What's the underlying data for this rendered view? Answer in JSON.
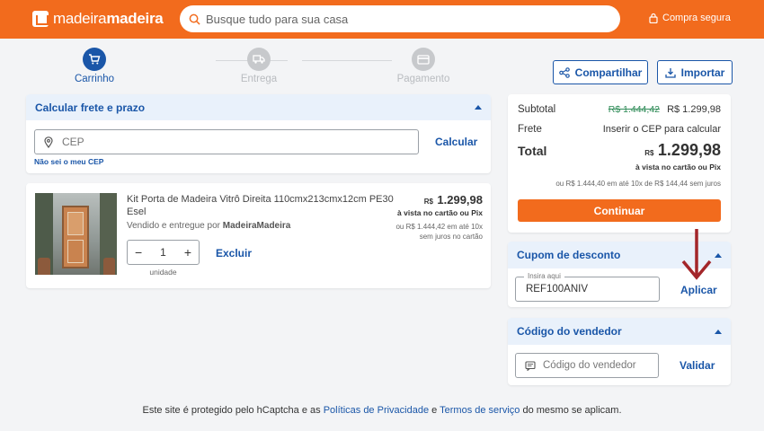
{
  "header": {
    "logo_part1": "madeira",
    "logo_part2": "madeira",
    "search_placeholder": "Busque tudo para sua casa",
    "secure_label": "Compra segura"
  },
  "steps": [
    {
      "label": "Carrinho",
      "icon": "cart-icon",
      "active": true
    },
    {
      "label": "Entrega",
      "icon": "truck-icon",
      "active": false
    },
    {
      "label": "Pagamento",
      "icon": "card-icon",
      "active": false
    }
  ],
  "actions": {
    "share_label": "Compartilhar",
    "import_label": "Importar"
  },
  "shipping": {
    "title": "Calcular frete e prazo",
    "cep_placeholder": "CEP",
    "calc_label": "Calcular",
    "unknown_cep_link": "Não sei o meu CEP"
  },
  "product": {
    "name": "Kit Porta de Madeira Vitrô Direita 110cmx213cmx12cm PE30 Esel",
    "seller_prefix": "Vendido e entregue por",
    "seller": "MadeiraMadeira",
    "quantity": "1",
    "quantity_unit": "unidade",
    "remove_label": "Excluir",
    "currency": "R$",
    "price": "1.299,98",
    "price_note": "à vista no cartão ou Pix",
    "installment_line1": "ou R$ 1.444,42 em até 10x",
    "installment_line2": "sem juros no cartão",
    "minus": "−",
    "plus": "+"
  },
  "summary": {
    "subtotal_label": "Subtotal",
    "subtotal_old": "R$ 1.444,42",
    "subtotal_new": "R$ 1.299,98",
    "frete_label": "Frete",
    "frete_value": "Inserir o CEP para calcular",
    "total_label": "Total",
    "total_currency": "R$",
    "total_value": "1.299,98",
    "total_note": "à vista no cartão ou Pix",
    "installments": "ou R$ 1.444,40 em até 10x de R$ 144,44 sem juros",
    "continue_label": "Continuar"
  },
  "coupon": {
    "title": "Cupom de desconto",
    "field_label": "Insira aqui",
    "value": "REF100ANIV",
    "apply_label": "Aplicar",
    "arrow_color": "#a3262a"
  },
  "seller_code": {
    "title": "Código do vendedor",
    "placeholder": "Código do vendedor",
    "validate_label": "Validar"
  },
  "footer": {
    "text1": "Este site é protegido pelo hCaptcha e as",
    "privacy_link": "Políticas de Privacidade",
    "text2": "e",
    "terms_link": "Termos de serviço",
    "text3": "do mesmo se aplicam."
  },
  "colors": {
    "brand": "#f26b1d",
    "primary": "#1a56a8",
    "price_old": "#2e8b57"
  }
}
